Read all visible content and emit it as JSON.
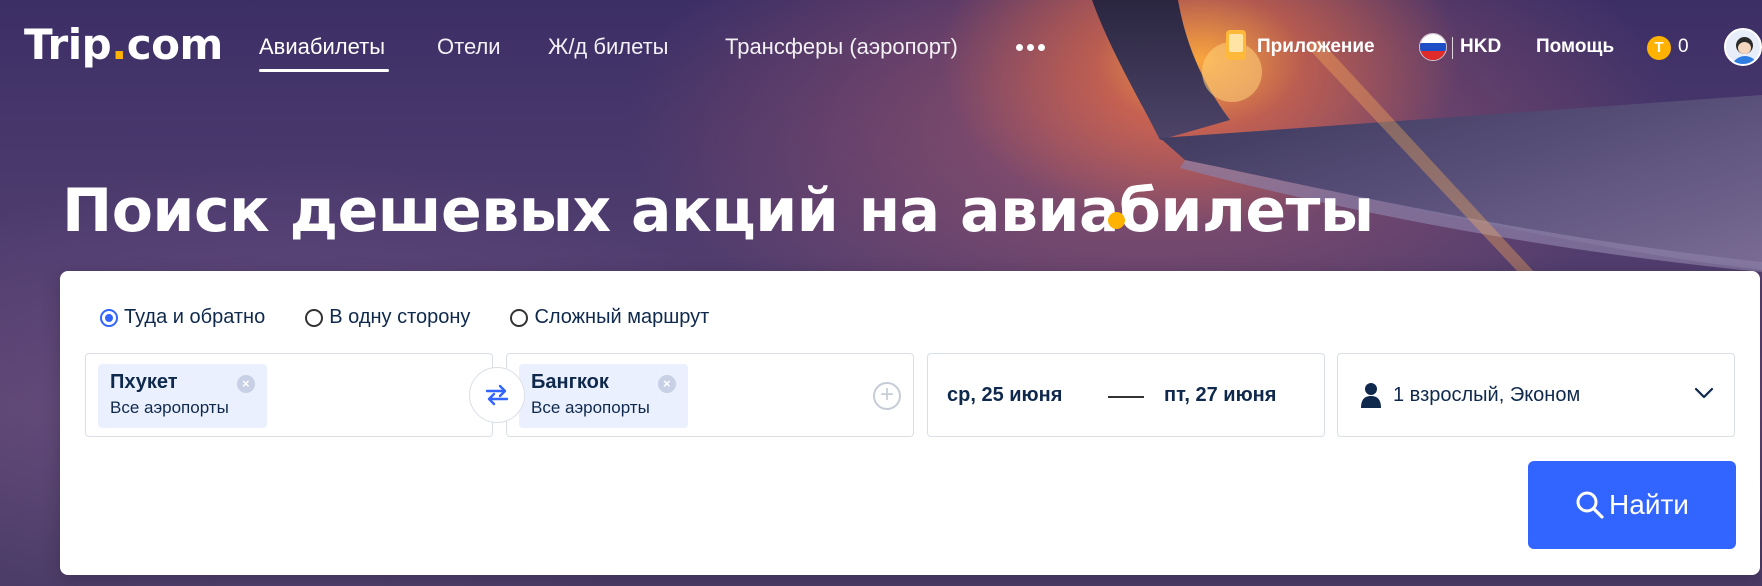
{
  "brand": {
    "logo_prefix": "Trip",
    "logo_dot": ".",
    "logo_suffix": "com"
  },
  "nav": {
    "items": [
      {
        "label": "Авиабилеты",
        "active": true
      },
      {
        "label": "Отели"
      },
      {
        "label": "Ж/д билеты"
      },
      {
        "label": "Трансферы (аэропорт)"
      }
    ],
    "more_icon": "more-dots-icon"
  },
  "header_right": {
    "app_label": "Приложение",
    "currency": "HKD",
    "help_label": "Помощь",
    "coins": "0",
    "coin_letter": "T"
  },
  "headline": "Поиск дешевых акций на авиабилеты",
  "search": {
    "trip_types": [
      {
        "label": "Туда и обратно",
        "checked": true
      },
      {
        "label": "В одну сторону",
        "checked": false
      },
      {
        "label": "Сложный маршрут",
        "checked": false
      }
    ],
    "from": {
      "city": "Пхукет",
      "airports": "Все аэропорты"
    },
    "to": {
      "city": "Бангкок",
      "airports": "Все аэропорты"
    },
    "depart_date": "ср, 25 июня",
    "return_date": "пт, 27 июня",
    "passengers": "1 взрослый, Эконом",
    "search_label": "Найти"
  },
  "colors": {
    "accent": "#3264ff",
    "brand_dot": "#ffb300",
    "text": "#0f294d"
  }
}
